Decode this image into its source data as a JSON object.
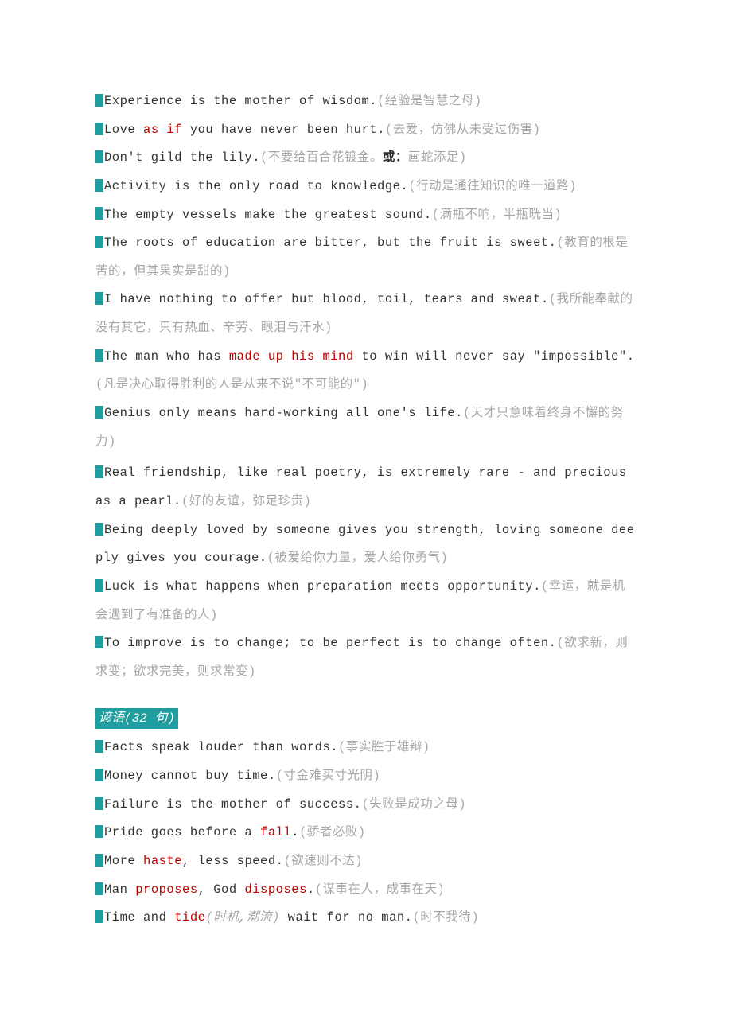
{
  "quotes": [
    {
      "en": "Experience is the mother of wisdom.",
      "zh_pre": "(",
      "zh": "经验是智慧之母",
      "zh_post": ")"
    },
    {
      "en_pre": "Love ",
      "hl": " as if ",
      "en_post": " you have never been hurt.",
      "zh_pre": "(",
      "zh": "去爱，仿佛从未受过伤害",
      "zh_post": ")"
    },
    {
      "en": "Don't gild the lily.",
      "zh_pre": "(",
      "zh": "不要给百合花镀金。",
      "bold": "或：",
      "zh2": "画蛇添足",
      "zh_post": ")"
    },
    {
      "en": "Activity is the only road to knowledge.",
      "zh_pre": "(",
      "zh": "行动是通往知识的唯一道路",
      "zh_post": ")"
    },
    {
      "en": "The empty vessels make the greatest sound.",
      "zh_pre": "(",
      "zh": "满瓶不响，半瓶晄当",
      "zh_post": ")"
    },
    {
      "en": "The roots of education are bitter, but the fruit is sweet.",
      "zh_pre": "(",
      "zh": "教育的根是苦的，但其果实是甜的",
      "zh_post": ")"
    },
    {
      "en": "I have nothing to offer but blood, toil, tears and sweat.",
      "zh_pre": "(",
      "zh": "我所能奉献的没有其它，只有热血、辛劳、眼泪与汗水",
      "zh_post": ")"
    },
    {
      "en_pre": "The man who has ",
      "hl": " made up his mind ",
      "en_post": " to win will never say \"impossible\".",
      "zh_pre": "(",
      "zh": "凡是决心取得胜利的人是从来不说\"不可能的\"",
      "zh_post": ")"
    },
    {
      "en": "Genius only means hard-working all one's life.",
      "zh_pre": "(",
      "zh": "天才只意味着终身不懈的努力",
      "zh_post": ")"
    },
    {
      "en": "Real friendship, like real poetry, is extremely rare - and precious as a pearl.",
      "zh_pre": "(",
      "zh": "好的友谊，弥足珍贵",
      "zh_post": ")"
    },
    {
      "en": "Being deeply loved by someone gives you strength, loving someone deeply gives you courage.",
      "zh_pre": "(",
      "zh": "被爱给你力量，爱人给你勇气",
      "zh_post": ")"
    },
    {
      "en": "Luck is what happens when preparation meets opportunity.",
      "zh_pre": "(",
      "zh": "幸运，就是机会遇到了有准备的人",
      "zh_post": ")"
    },
    {
      "en": "To improve is to change; to be perfect is to change often.",
      "zh_pre": "(",
      "zh": "欲求新，则求变；欲求完美，则求常变",
      "zh_post": ")"
    }
  ],
  "section_header": "谚语(32 句)",
  "proverbs": [
    {
      "en": "Facts speak louder than words.",
      "zh": "事实胜于雄辩"
    },
    {
      "en": "Money cannot buy time.",
      "zh": "寸金难买寸光阴"
    },
    {
      "en": "Failure is the mother of success.",
      "zh": "失败是成功之母"
    },
    {
      "en_pre": "Pride goes before a ",
      "hl": " fall",
      "en_post": ".",
      "zh": "骄者必败"
    },
    {
      "en_pre": "More ",
      "hl": " haste",
      "en_post": ", less speed.",
      "zh": "欲速则不达"
    },
    {
      "en_pre": "Man ",
      "hl": " proposes",
      "en_mid": ", God ",
      "hl2": " disposes",
      "en_post": ".",
      "zh": "谋事在人，成事在天"
    },
    {
      "en_pre": "Time and ",
      "hl": " tide",
      "paren_it": "(时机,潮流)",
      "en_post": " wait for no man.",
      "zh": "时不我待"
    }
  ]
}
